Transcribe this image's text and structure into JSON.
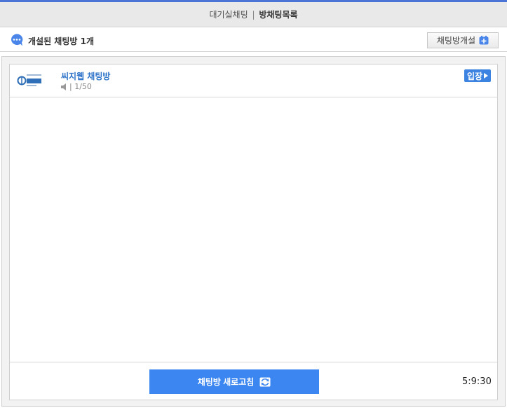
{
  "header": {
    "tab_waiting": "대기실채팅",
    "separator": "|",
    "tab_rooms": "방채팅목록"
  },
  "subbar": {
    "count_text": "개설된 채팅방 1개",
    "create_label": "채팅방개설",
    "icon": "chat-bubble-icon"
  },
  "rooms": [
    {
      "name": "씨지웹 채팅방",
      "meta": "| 1/50",
      "enter_label": "입장"
    }
  ],
  "footer": {
    "refresh_label": "채팅방 새로고침",
    "clock": "5:9:30"
  },
  "colors": {
    "accent": "#4a74d6",
    "primary_button": "#3b86f0",
    "room_title": "#2f74c8"
  }
}
